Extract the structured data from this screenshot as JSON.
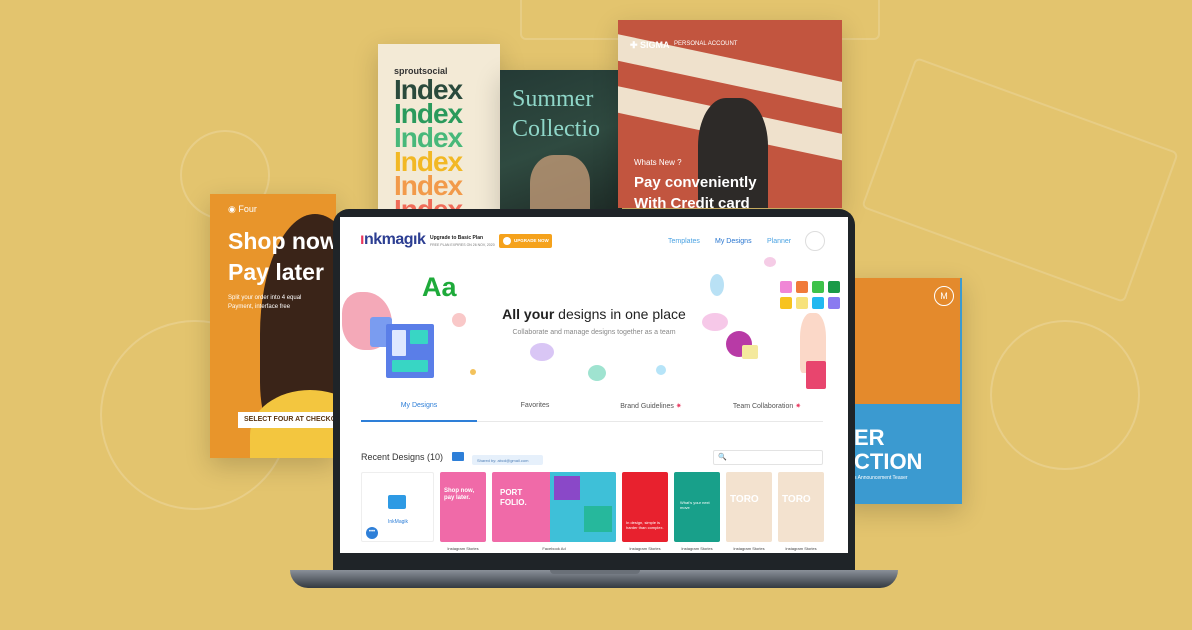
{
  "background_cards": {
    "index_card": {
      "brand": "sproutsocial",
      "words": [
        "Index",
        "Index",
        "Index",
        "Index",
        "Index",
        "Index"
      ]
    },
    "summer_card": {
      "line1": "Summer",
      "line2": "Collectio"
    },
    "sigma_card": {
      "logo": "✚ SIGMA",
      "account": "PERSONAL ACCOUNT",
      "whats_new": "Whats New ?",
      "line1": "Pay conveniently",
      "line2": "With Credit card"
    },
    "four_card": {
      "logo": "◉ Four",
      "line1": "Shop now",
      "line2": "Pay later",
      "sub1": "Split your order into 4 equal",
      "sub2": "Payment, interface free",
      "cta": "SELECT FOUR AT CHECKOUT"
    },
    "collection_card": {
      "badge": "M",
      "line1": "ER",
      "line2": "CTION",
      "sub": "s Announcement Teaser"
    }
  },
  "app": {
    "logo_prefix": "ı",
    "logo_text": "nkmagık",
    "upgrade_title": "Upgrade to Basic Plan",
    "upgrade_sub": "FREE PLAN EXPIRES ON 26 NOV, 2020",
    "upgrade_button": "UPGRADE NOW",
    "nav": [
      "Templates",
      "My Designs",
      "Planner"
    ],
    "hero": {
      "title_bold": "All your",
      "title_rest": " designs in one place",
      "subtitle": "Collaborate and manage designs together as a team",
      "aa": "Aa"
    },
    "tabs": [
      {
        "label": "My Designs",
        "star": ""
      },
      {
        "label": "Favorites",
        "star": ""
      },
      {
        "label": "Brand Guidelines",
        "star": "✷"
      },
      {
        "label": "Team Collaboration",
        "star": "✷"
      }
    ],
    "recent_title": "Recent Designs (10)",
    "shared_pill": "Shared by: abcd@gmail.com",
    "search_placeholder": "",
    "folder_label": "InkMagik",
    "more_label": "•••",
    "thumbs": [
      {
        "caption": "Instagram Stories",
        "text": "Shop now, pay later."
      },
      {
        "caption": "Facebook Ad",
        "text": "PORT FOLIO."
      },
      {
        "caption": "Instagram Stories",
        "text": "In design, simple is harder than complex."
      },
      {
        "caption": "Instagram Stories",
        "text": "What's your next move"
      },
      {
        "caption": "Instagram Stories",
        "text": "TORO"
      },
      {
        "caption": "Instagram Stories",
        "text": "TORO"
      }
    ]
  }
}
